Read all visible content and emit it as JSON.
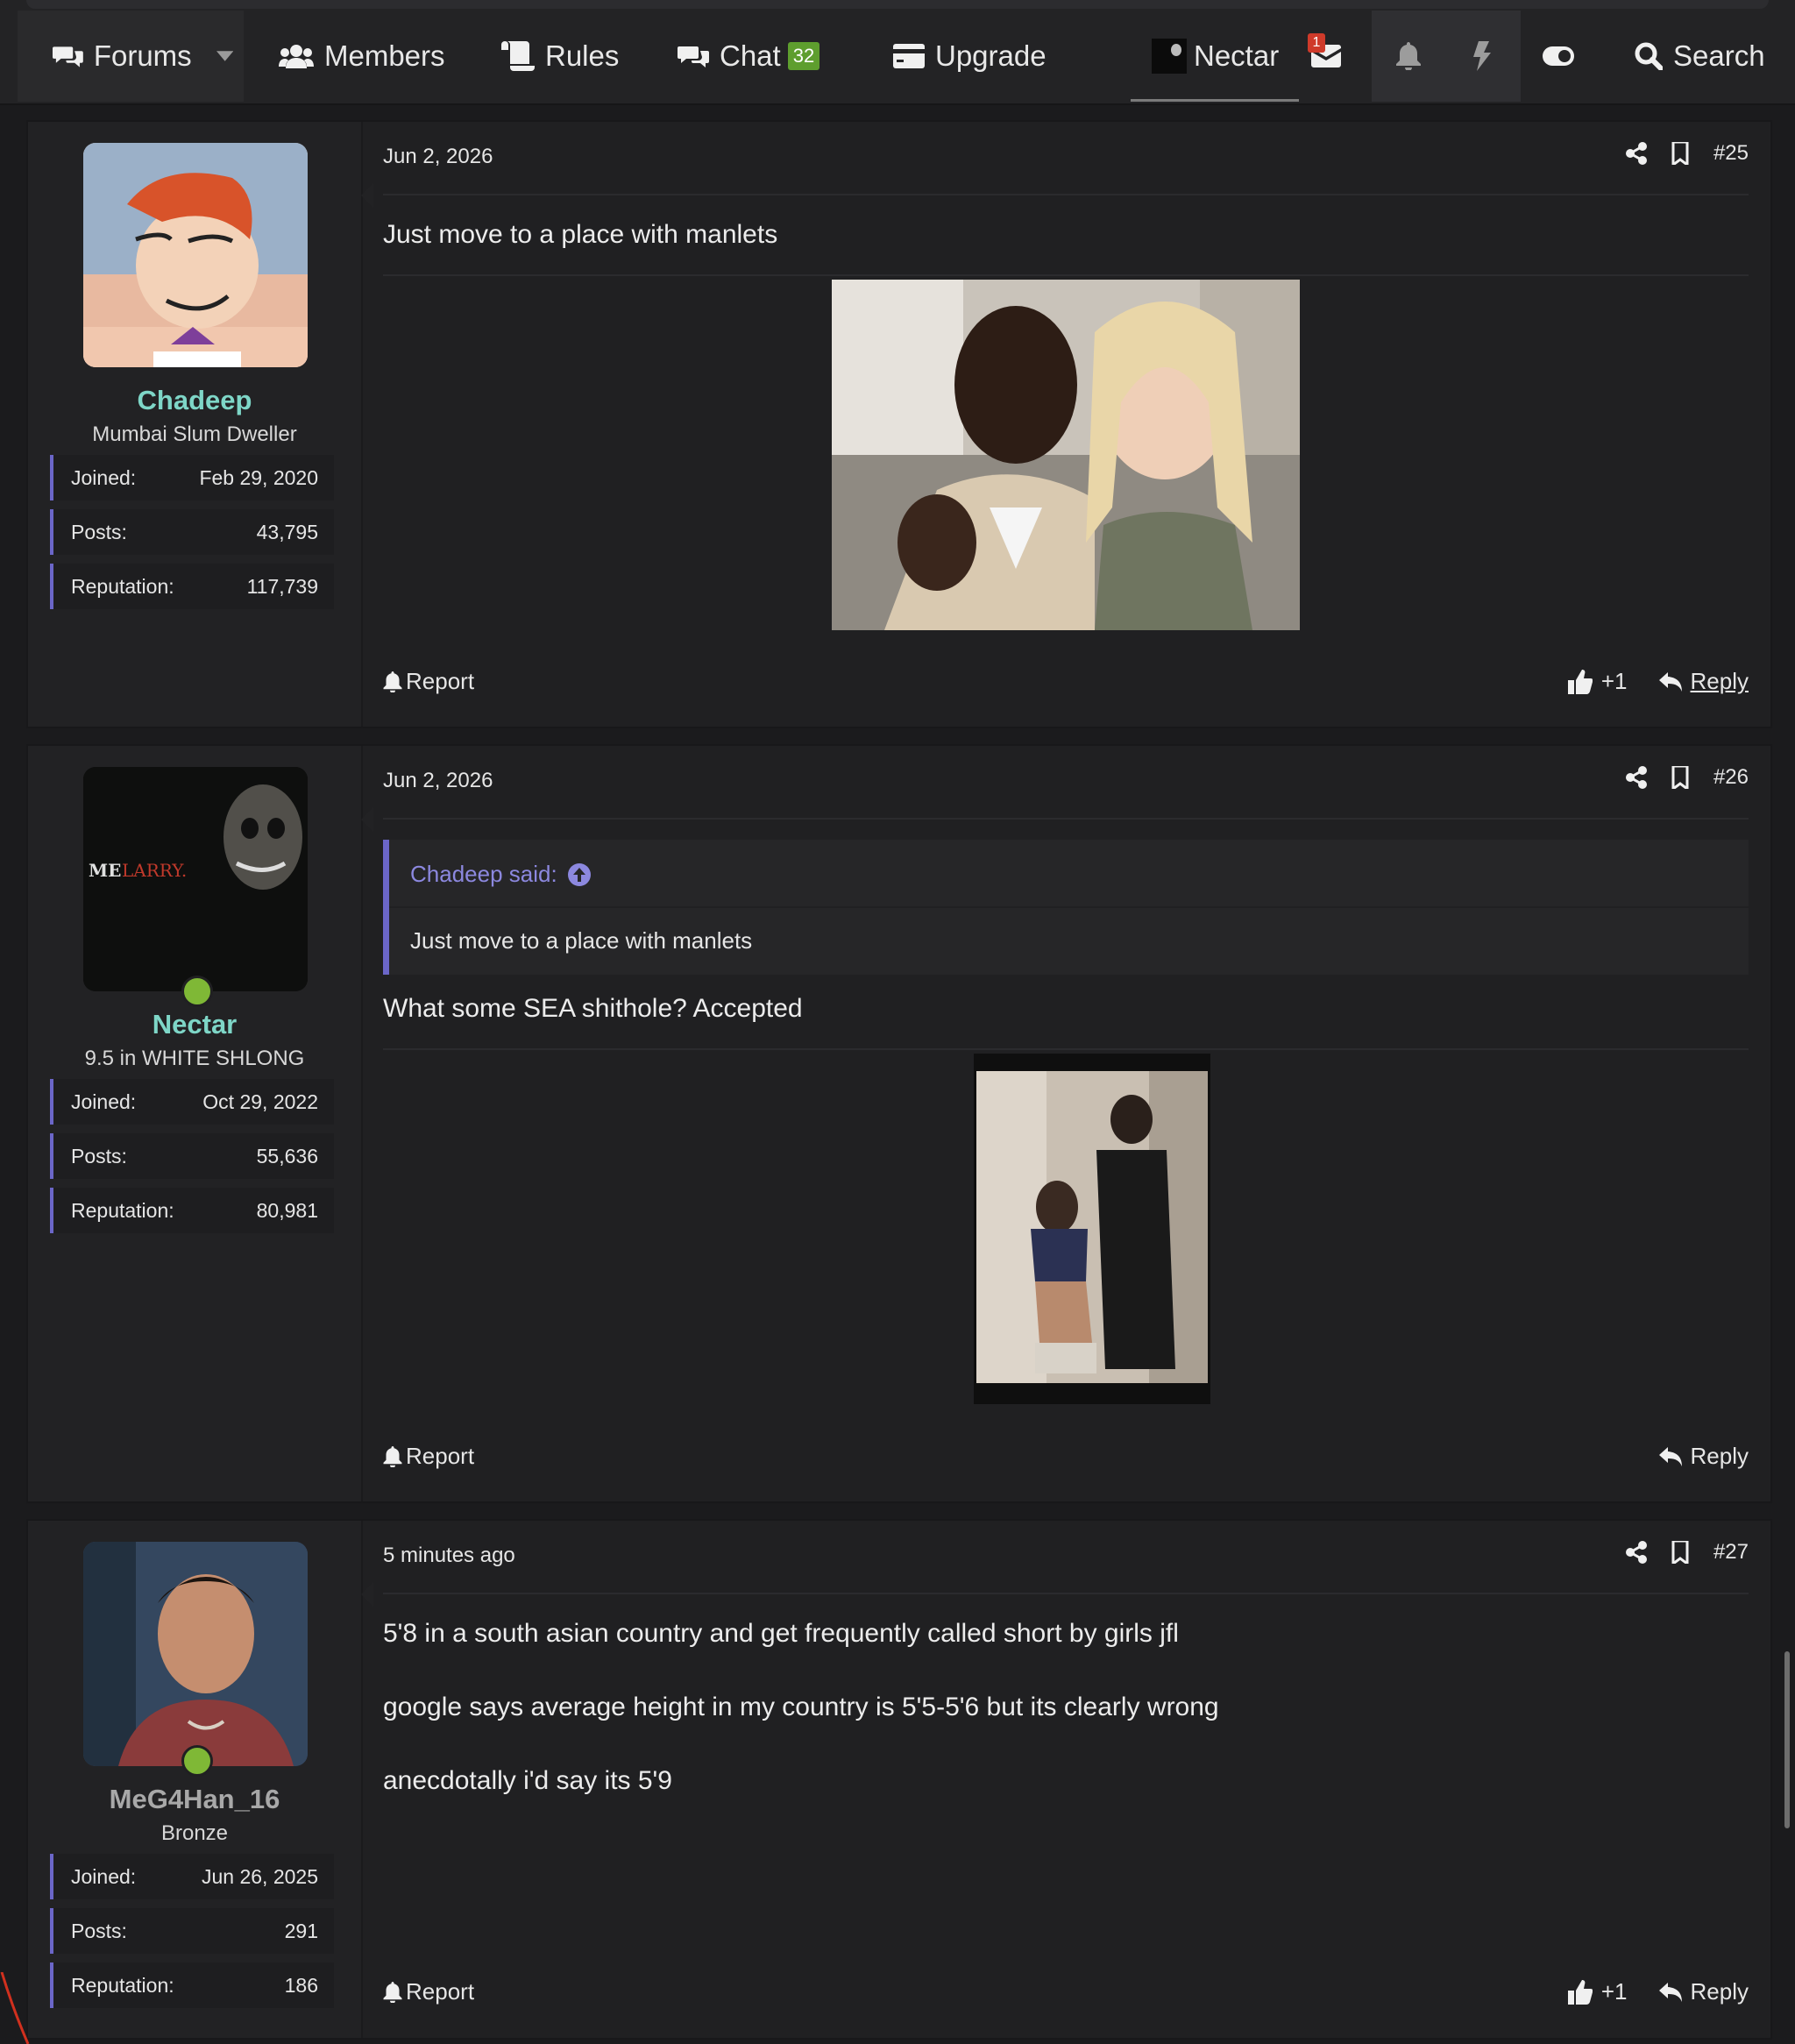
{
  "nav": {
    "forums": "Forums",
    "members": "Members",
    "rules": "Rules",
    "chat": "Chat",
    "chat_count": "32",
    "upgrade": "Upgrade",
    "user": "Nectar",
    "inbox_count": "1",
    "search": "Search"
  },
  "posts": [
    {
      "user": {
        "name": "Chadeep",
        "name_color": "#7ed6c7",
        "title": "Mumbai Slum Dweller",
        "online": false,
        "joined_label": "Joined:",
        "joined": "Feb 29, 2020",
        "posts_label": "Posts:",
        "posts": "43,795",
        "rep_label": "Reputation:",
        "rep": "117,739"
      },
      "date": "Jun 2, 2026",
      "number": "#25",
      "text": "Just move to a place with manlets",
      "report": "Report",
      "reaction": "+1",
      "reply": "Reply"
    },
    {
      "user": {
        "name": "Nectar",
        "name_color": "#7ed6c7",
        "title": "9.5 in WHITE SHLONG",
        "avatar_text_1": "ME",
        "avatar_text_2": "LARRY.",
        "online": true,
        "joined_label": "Joined:",
        "joined": "Oct 29, 2022",
        "posts_label": "Posts:",
        "posts": "55,636",
        "rep_label": "Reputation:",
        "rep": "80,981"
      },
      "date": "Jun 2, 2026",
      "number": "#26",
      "quote_author": "Chadeep said:",
      "quote_text": "Just move to a place with manlets",
      "text": "What some SEA shithole? Accepted",
      "report": "Report",
      "reply": "Reply"
    },
    {
      "user": {
        "name": "MeG4Han_16",
        "name_color": "#a8a8a8",
        "title": "Bronze",
        "online": true,
        "joined_label": "Joined:",
        "joined": "Jun 26, 2025",
        "posts_label": "Posts:",
        "posts": "291",
        "rep_label": "Reputation:",
        "rep": "186"
      },
      "date": "5 minutes ago",
      "number": "#27",
      "lines": [
        "5'8 in a south asian country and get frequently called short by girls jfl",
        "google says average height in my country is 5'5-5'6 but its clearly wrong",
        "anecdotally i'd say its 5'9"
      ],
      "report": "Report",
      "reaction": "+1",
      "reply": "Reply"
    }
  ],
  "colors": {
    "accent": "#6b66c8",
    "online": "#7fb836",
    "quote_author": "#8c88df"
  }
}
